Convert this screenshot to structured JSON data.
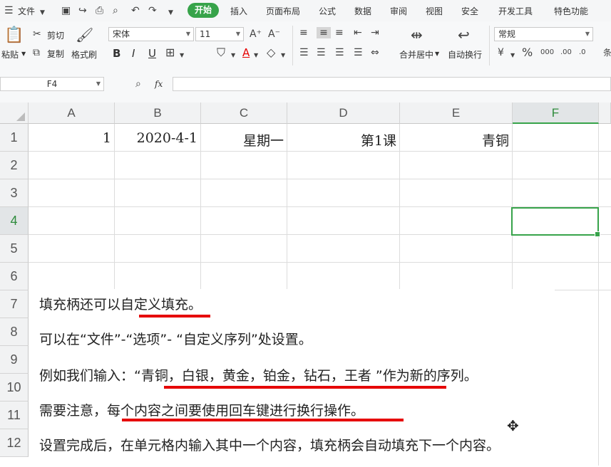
{
  "tabbar": {
    "file_menu": "文件",
    "tabs": [
      "开始",
      "插入",
      "页面布局",
      "公式",
      "数据",
      "审阅",
      "视图",
      "安全",
      "开发工具",
      "特色功能"
    ],
    "active_tab": "开始"
  },
  "ribbon": {
    "paste": "粘贴",
    "cut": "剪切",
    "copy": "复制",
    "format_painter": "格式刷",
    "font_name": "宋体",
    "font_size": "11",
    "merge_center": "合并居中",
    "wrap_text": "自动换行",
    "number_format": "常规",
    "bold": "B",
    "italic": "I",
    "underline": "U",
    "font_color_letter": "A",
    "accent_color": "#37a34a",
    "underline_color": "#e60000"
  },
  "formula_bar": {
    "name_box": "F4",
    "fx_label": "fx",
    "value": ""
  },
  "sheet": {
    "columns": [
      "A",
      "B",
      "C",
      "D",
      "E",
      "F"
    ],
    "rows": [
      "1",
      "2",
      "3",
      "4",
      "5",
      "6",
      "7",
      "8",
      "9",
      "10",
      "11",
      "12"
    ],
    "selected_cell": "F4",
    "row1": {
      "A": "1",
      "B": "2020-4-1",
      "C": "星期一",
      "D": "第1课",
      "E": "青铜"
    }
  },
  "annotations": {
    "line1": "填充柄还可以自定义填充。",
    "line2": "可以在“文件”-“选项”- “自定义序列”处设置。",
    "line3": "例如我们输入：“青铜，白银，黄金，铂金，钻石，王者 ”作为新的序列。",
    "line4": "需要注意，每个内容之间要使用回车键进行换行操作。",
    "line5": "设置完成后，在单元格内输入其中一个内容，填充柄会自动填充下一个内容。"
  }
}
